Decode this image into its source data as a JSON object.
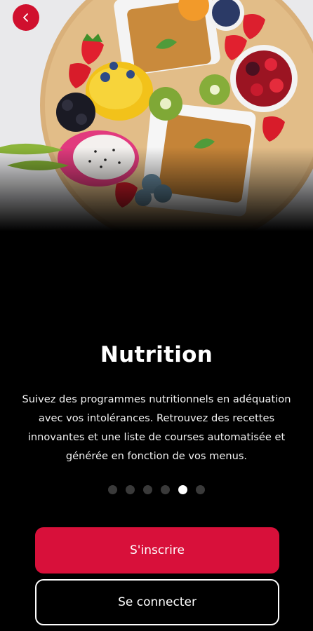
{
  "header": {
    "back_icon": "chevron-left-icon",
    "back_button_color": "#d0102e"
  },
  "hero": {
    "image_subject": "fruit-platter-photo"
  },
  "content": {
    "title": "Nutrition",
    "description": "Suivez des programmes nutritionnels en adéquation avec vos intolérances. Retrouvez des recettes innovantes et une liste de courses automatisée et générée en fonction de vos menus."
  },
  "pagination": {
    "total": 6,
    "active_index": 4
  },
  "actions": {
    "signup_label": "S'inscrire",
    "login_label": "Se connecter",
    "primary_color": "#d8103a"
  }
}
